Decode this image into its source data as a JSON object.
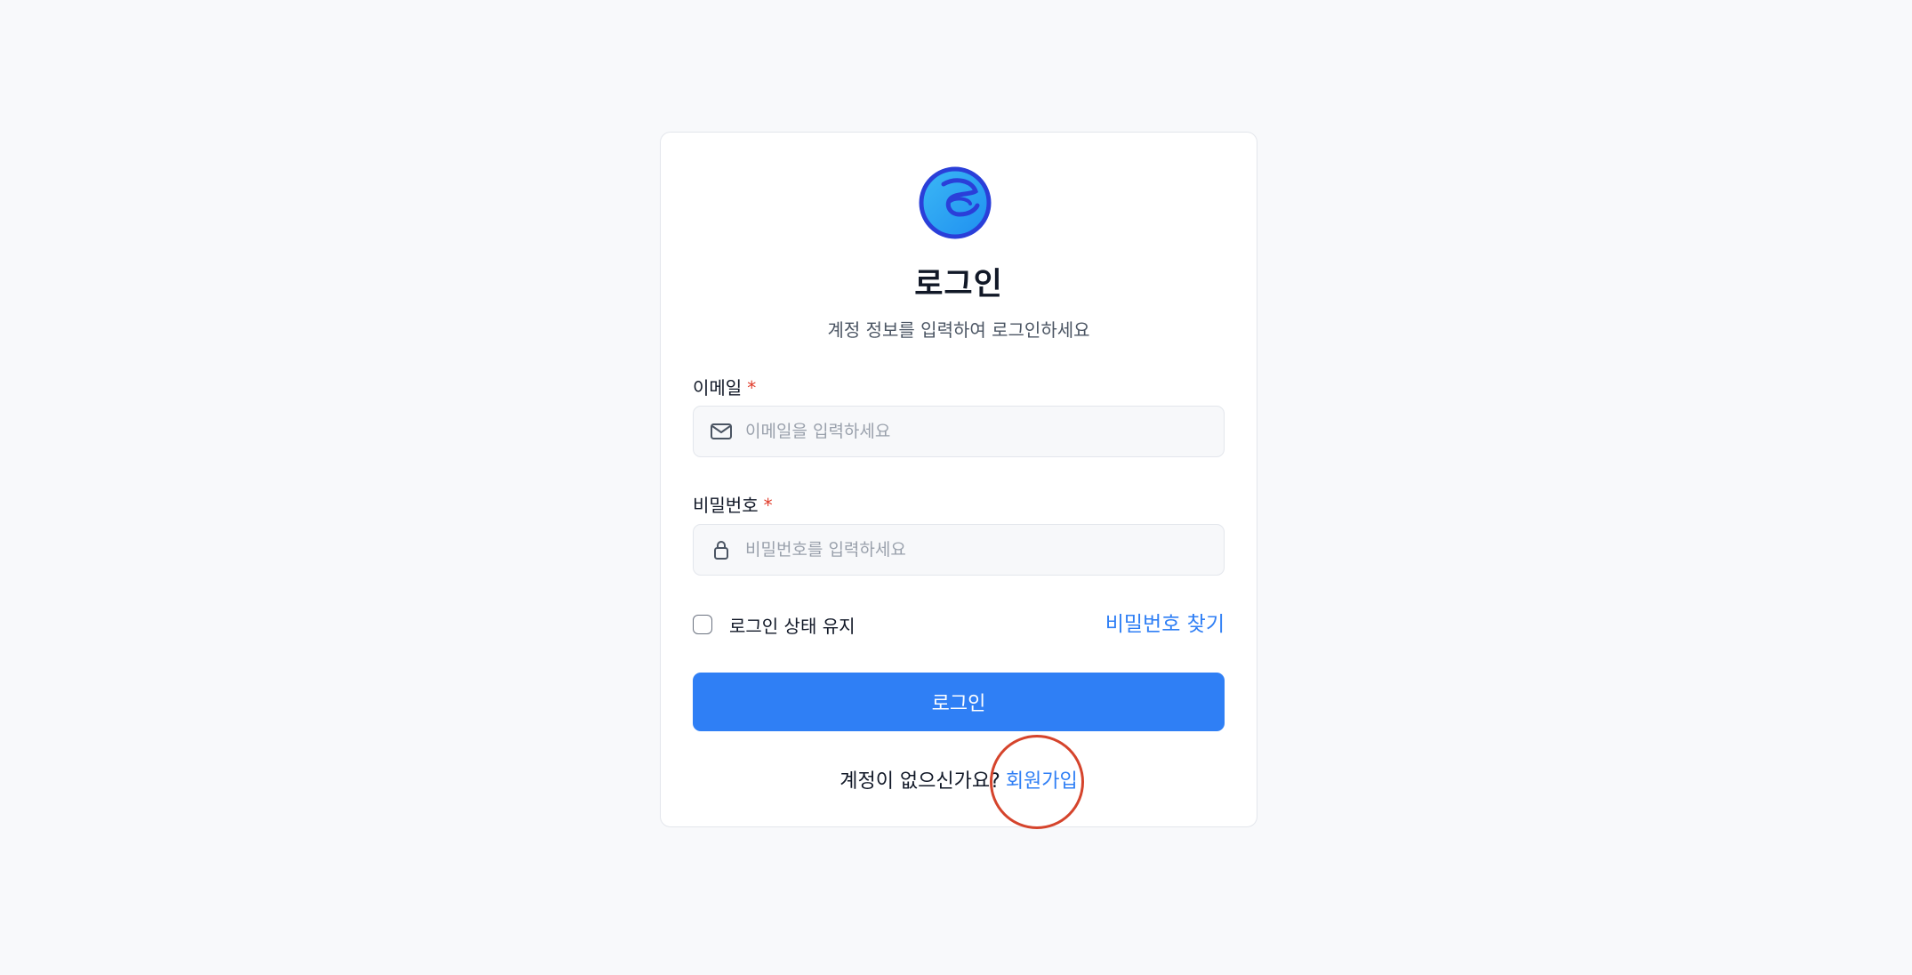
{
  "login": {
    "title": "로그인",
    "subtitle": "계정 정보를 입력하여 로그인하세요",
    "email": {
      "label": "이메일",
      "required_mark": "*",
      "placeholder": "이메일을 입력하세요",
      "value": "",
      "icon": "mail-icon"
    },
    "password": {
      "label": "비밀번호",
      "required_mark": "*",
      "placeholder": "비밀번호를 입력하세요",
      "value": "",
      "icon": "lock-icon"
    },
    "remember_label": "로그인 상태 유지",
    "forgot_password": "비밀번호 찾기",
    "submit_label": "로그인",
    "signup_prompt": "계정이 없으신가요?",
    "signup_link": "회원가입"
  },
  "colors": {
    "background": "#f8f9fb",
    "accent": "#2f7ff5",
    "required": "#e03b2a",
    "highlight": "#d5442c"
  }
}
